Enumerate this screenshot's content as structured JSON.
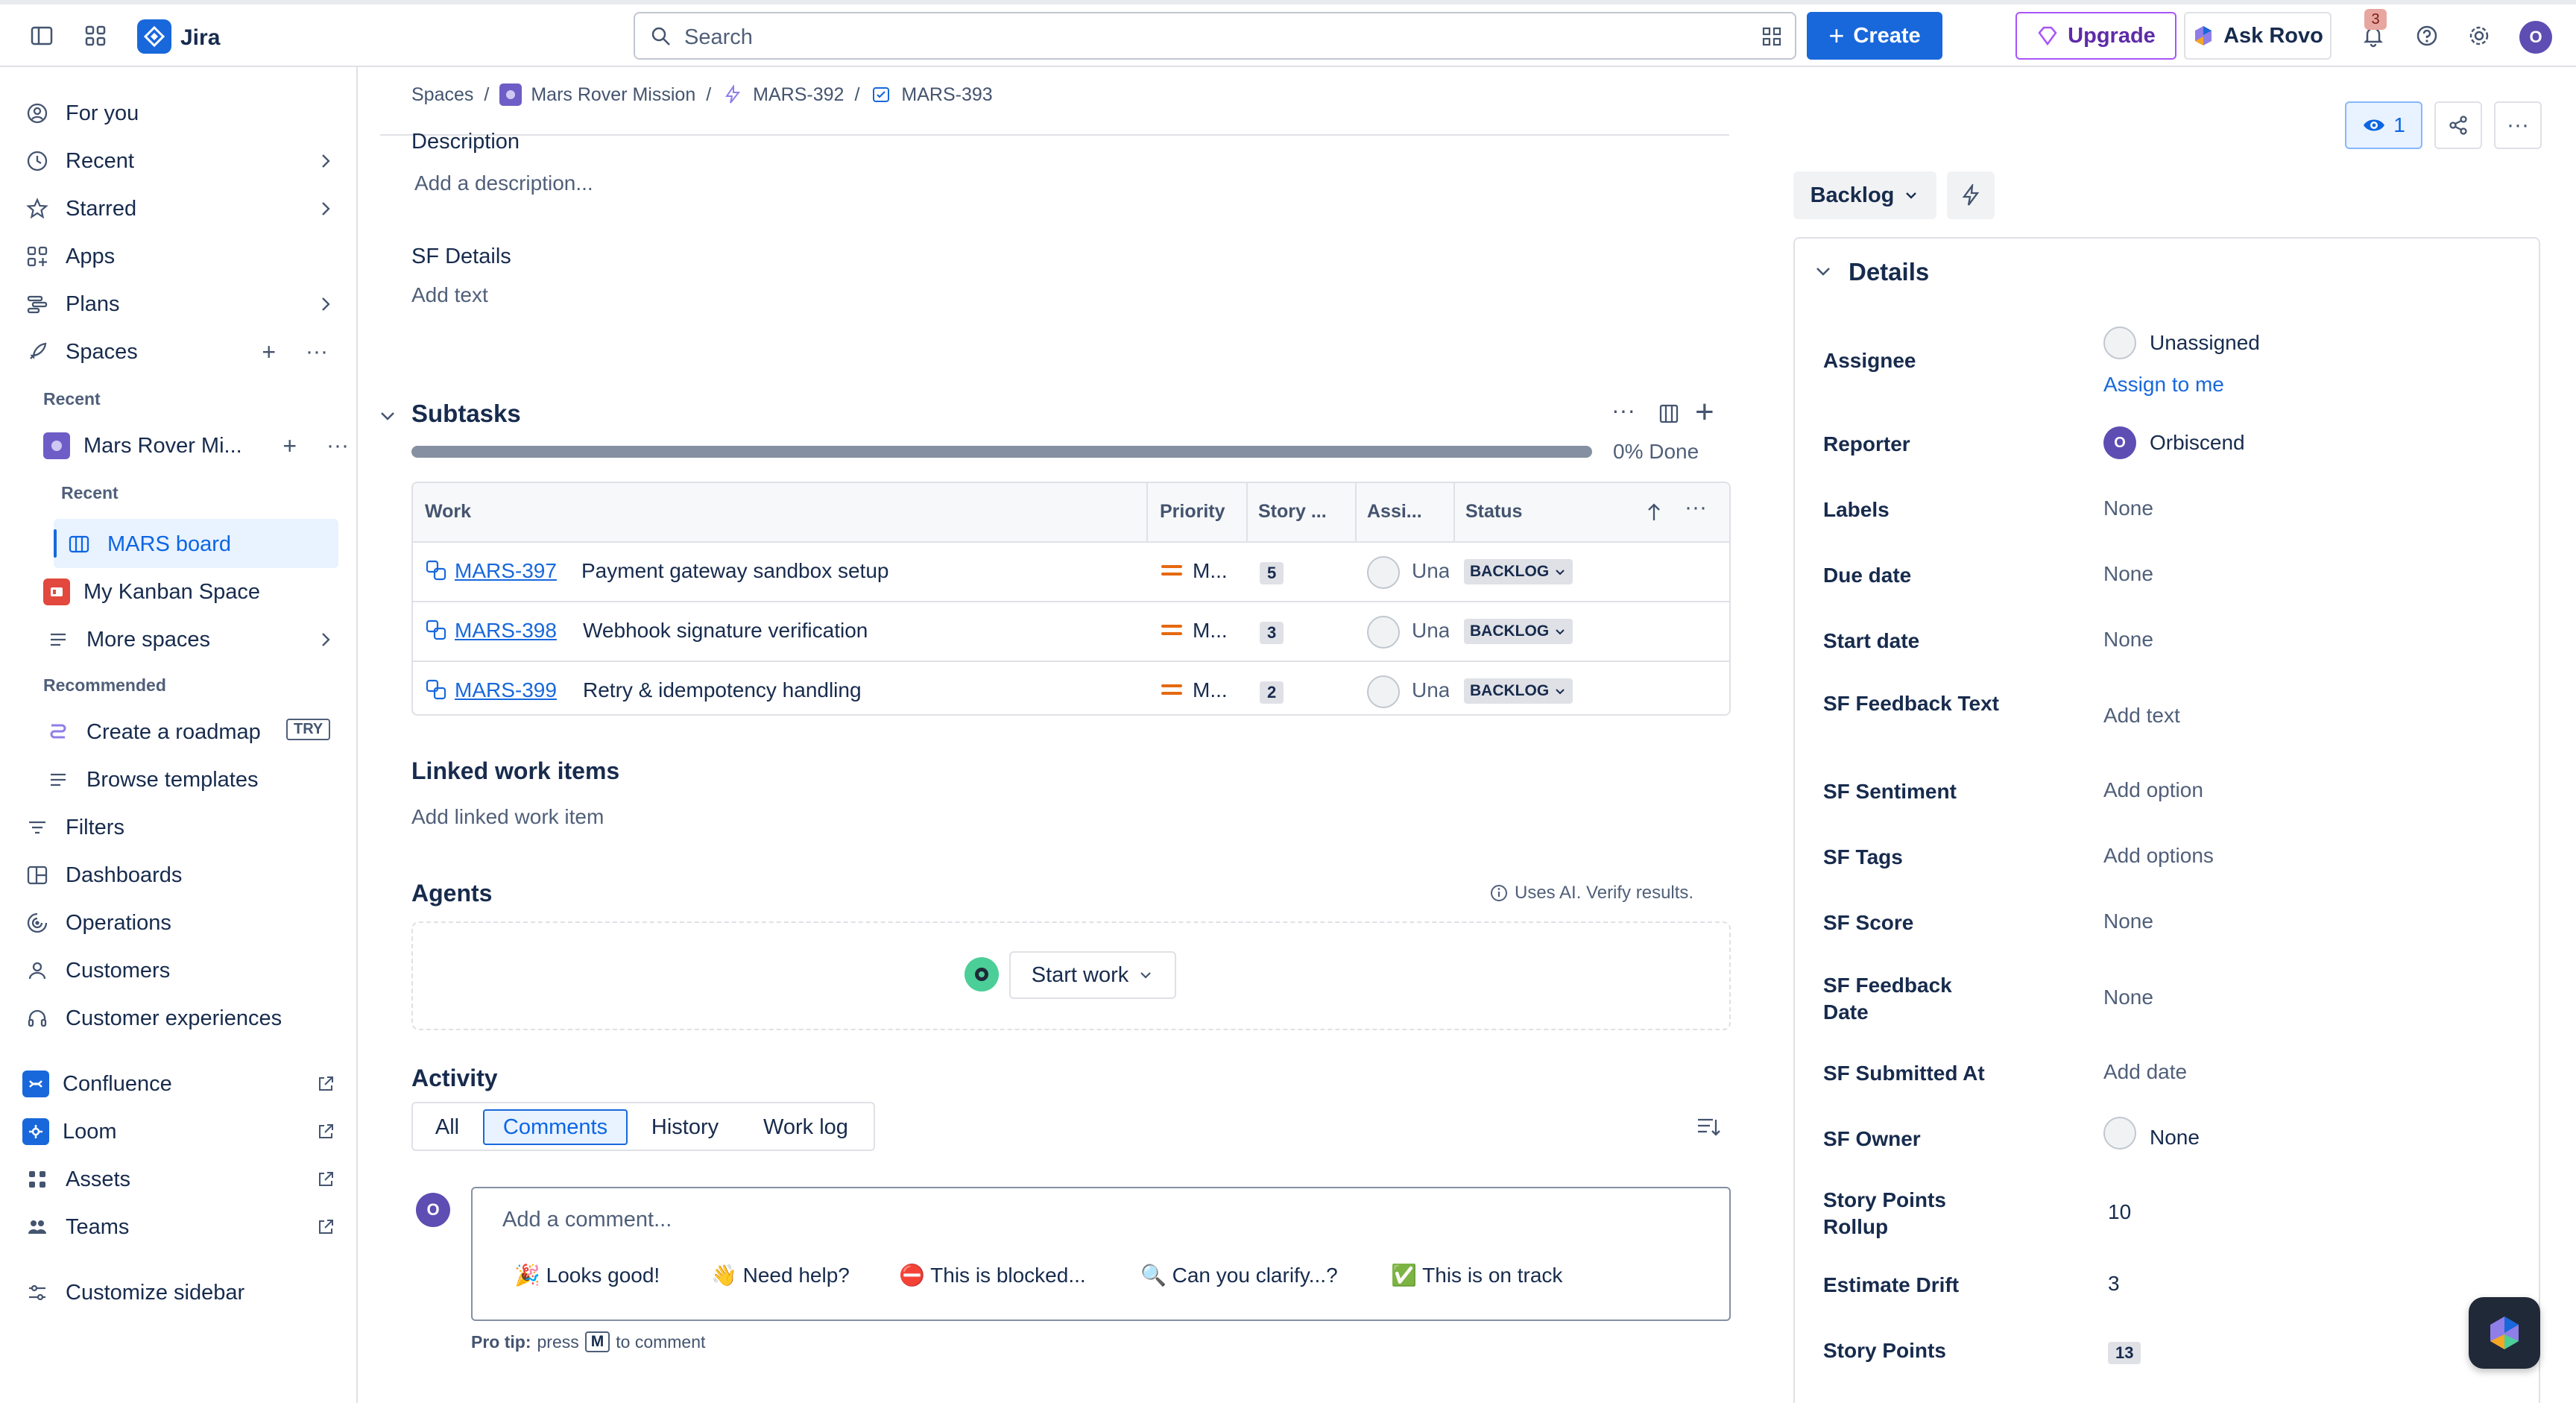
{
  "app": {
    "name": "Jira"
  },
  "search": {
    "placeholder": "Search"
  },
  "top": {
    "create": "Create",
    "upgrade": "Upgrade",
    "ask_rovo": "Ask Rovo",
    "notifications_count": "3",
    "avatar_initial": "O"
  },
  "sidebar": {
    "for_you": "For you",
    "recent": "Recent",
    "starred": "Starred",
    "apps": "Apps",
    "plans": "Plans",
    "spaces": "Spaces",
    "section_recent": "Recent",
    "space_name": "Mars Rover Mi...",
    "sub_recent": "Recent",
    "mars_board": "MARS board",
    "kanban": "My Kanban Space",
    "more_spaces": "More spaces",
    "section_recommended": "Recommended",
    "roadmap": "Create a roadmap",
    "try_badge": "TRY",
    "templates": "Browse templates",
    "filters": "Filters",
    "dashboards": "Dashboards",
    "operations": "Operations",
    "customers": "Customers",
    "customer_experiences": "Customer experiences",
    "confluence": "Confluence",
    "loom": "Loom",
    "assets": "Assets",
    "teams": "Teams",
    "customize": "Customize sidebar"
  },
  "breadcrumb": {
    "spaces": "Spaces",
    "project": "Mars Rover Mission",
    "parent": "MARS-392",
    "current": "MARS-393"
  },
  "issue": {
    "description_label": "Description",
    "description_placeholder": "Add a description...",
    "sf_details_label": "SF Details",
    "sf_details_placeholder": "Add text",
    "subtasks_title": "Subtasks",
    "progress_text": "0% Done",
    "progress_fraction": 0.0,
    "columns": [
      "Work",
      "Priority",
      "Story ...",
      "Assi...",
      "Status"
    ],
    "subtasks": [
      {
        "key": "MARS-397",
        "summary": "Payment gateway sandbox setup",
        "priority": "M...",
        "points": "5",
        "assignee": "Una",
        "status": "BACKLOG"
      },
      {
        "key": "MARS-398",
        "summary": "Webhook signature verification",
        "priority": "M...",
        "points": "3",
        "assignee": "Una",
        "status": "BACKLOG"
      },
      {
        "key": "MARS-399",
        "summary": "Retry & idempotency handling",
        "priority": "M...",
        "points": "2",
        "assignee": "Una",
        "status": "BACKLOG"
      }
    ],
    "linked_title": "Linked work items",
    "linked_placeholder": "Add linked work item",
    "agents_title": "Agents",
    "agents_note": "Uses AI. Verify results.",
    "start_work": "Start work",
    "activity_title": "Activity",
    "activity_tabs": [
      "All",
      "Comments",
      "History",
      "Work log"
    ],
    "activity_active": "Comments",
    "comment_placeholder": "Add a comment...",
    "quick_replies": [
      "🎉 Looks good!",
      "👋 Need help?",
      "⛔ This is blocked...",
      "🔍 Can you clarify...?",
      "✅ This is on track"
    ],
    "protip_prefix": "Pro tip:",
    "protip_press": "press",
    "protip_key": "M",
    "protip_suffix": "to comment",
    "commenter_initial": "O"
  },
  "panel": {
    "watch_count": "1",
    "status": "Backlog",
    "details_title": "Details",
    "fields": [
      {
        "label": "Assignee",
        "value": "Unassigned"
      },
      {
        "label": "Reporter",
        "value": "Orbiscend"
      },
      {
        "label": "Labels",
        "value": "None"
      },
      {
        "label": "Due date",
        "value": "None"
      },
      {
        "label": "Start date",
        "value": "None"
      },
      {
        "label": "SF Feedback Text",
        "value": "Add text"
      },
      {
        "label": "SF Sentiment",
        "value": "Add option"
      },
      {
        "label": "SF Tags",
        "value": "Add options"
      },
      {
        "label": "SF Score",
        "value": "None"
      },
      {
        "label": "SF Feedback Date",
        "value": "None"
      },
      {
        "label": "SF Submitted At",
        "value": "Add date"
      },
      {
        "label": "SF Owner",
        "value": "None"
      },
      {
        "label": "Story Points Rollup",
        "value": "10"
      },
      {
        "label": "Estimate Drift",
        "value": "3"
      },
      {
        "label": "Story Points",
        "value": "13"
      }
    ],
    "assign_to_me": "Assign to me",
    "reporter_initial": "O"
  },
  "icons": [
    "sidebar-toggle-icon",
    "app-switcher-icon",
    "search-icon",
    "bell-icon",
    "help-icon",
    "gear-icon"
  ]
}
